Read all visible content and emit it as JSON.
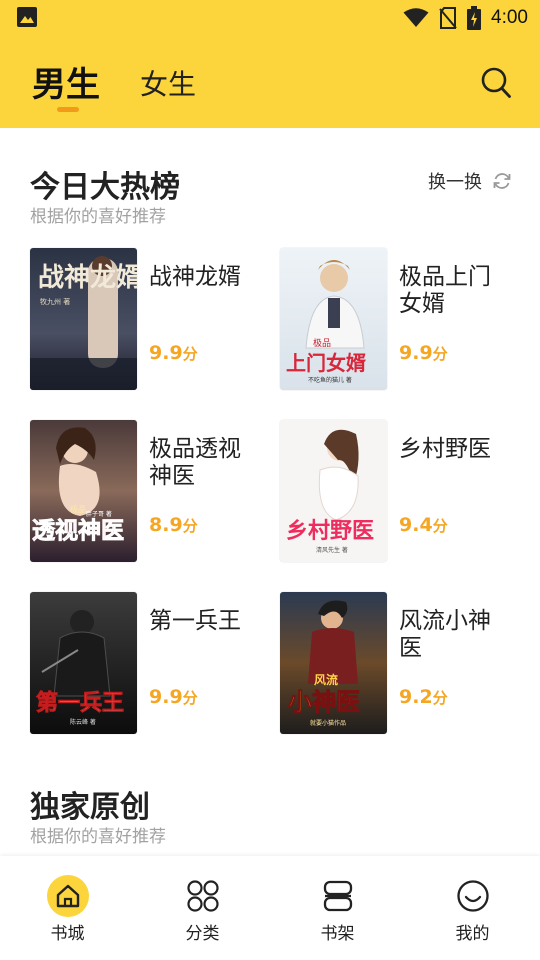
{
  "status_bar": {
    "time": "4:00",
    "icons": [
      "image-icon",
      "wifi-icon",
      "no-sim-icon",
      "battery-charging-icon"
    ]
  },
  "header": {
    "tabs": [
      {
        "label": "男生",
        "active": true
      },
      {
        "label": "女生",
        "active": false
      }
    ],
    "search_icon": "search-icon",
    "background_color": "#fbd53b",
    "indicator_color": "#f29a1a"
  },
  "hot_ranking": {
    "title": "今日大热榜",
    "subtitle": "根据你的喜好推荐",
    "refresh_label": "换一换",
    "refresh_icon": "refresh-icon",
    "books": [
      {
        "title": "战神龙婿",
        "score": "9.9",
        "unit": "分",
        "cover_text": "战神龙婿",
        "cover_author": "牧九州 著"
      },
      {
        "title": "极品上门女婿",
        "score": "9.9",
        "unit": "分",
        "cover_badge": "极品",
        "cover_text": "上门女婿",
        "cover_author": "不吃鱼的猫儿 著"
      },
      {
        "title": "极品透视神医",
        "score": "8.9",
        "unit": "分",
        "cover_badge": "极品",
        "cover_text": "透视神医",
        "cover_author": "胖子哥 著"
      },
      {
        "title": "乡村野医",
        "score": "9.4",
        "unit": "分",
        "cover_text": "乡村野医",
        "cover_author": "清风先生 著"
      },
      {
        "title": "第一兵王",
        "score": "9.9",
        "unit": "分",
        "cover_text": "第一兵王",
        "cover_author": "陈云峰 著"
      },
      {
        "title": "风流小神医",
        "score": "9.2",
        "unit": "分",
        "cover_badge": "风流",
        "cover_text": "小神医",
        "cover_author": "就要小猫作品"
      }
    ]
  },
  "original": {
    "title": "独家原创",
    "subtitle": "根据你的喜好推荐"
  },
  "bottom_nav": {
    "items": [
      {
        "label": "书城",
        "icon": "home-icon",
        "active": true
      },
      {
        "label": "分类",
        "icon": "category-icon",
        "active": false
      },
      {
        "label": "书架",
        "icon": "bookshelf-icon",
        "active": false
      },
      {
        "label": "我的",
        "icon": "profile-icon",
        "active": false
      }
    ],
    "active_color": "#fbd53b"
  },
  "colors": {
    "accent": "#fbd53b",
    "score": "#f5a623",
    "subtitle": "#a2a2a2"
  }
}
